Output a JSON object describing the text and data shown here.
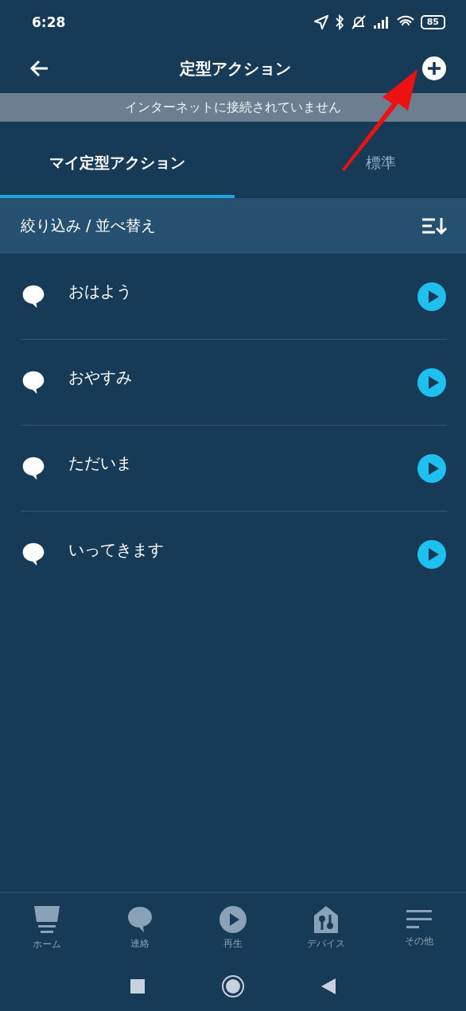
{
  "status_bar": {
    "time": "6:28",
    "battery": "85"
  },
  "header": {
    "title": "定型アクション"
  },
  "banner": {
    "text": "インターネットに接続されていません"
  },
  "tabs": [
    {
      "label": "マイ定型アクション",
      "selected": true
    },
    {
      "label": "標準",
      "selected": false
    }
  ],
  "filter_bar": {
    "label": "絞り込み / 並べ替え"
  },
  "routines": [
    {
      "name": "おはよう"
    },
    {
      "name": "おやすみ"
    },
    {
      "name": "ただいま"
    },
    {
      "name": "いってきます"
    }
  ],
  "bottom_nav": [
    {
      "label": "ホーム",
      "kind": "home"
    },
    {
      "label": "連絡",
      "kind": "chat"
    },
    {
      "label": "再生",
      "kind": "play"
    },
    {
      "label": "デバイス",
      "kind": "devices"
    },
    {
      "label": "その他",
      "kind": "more"
    }
  ]
}
